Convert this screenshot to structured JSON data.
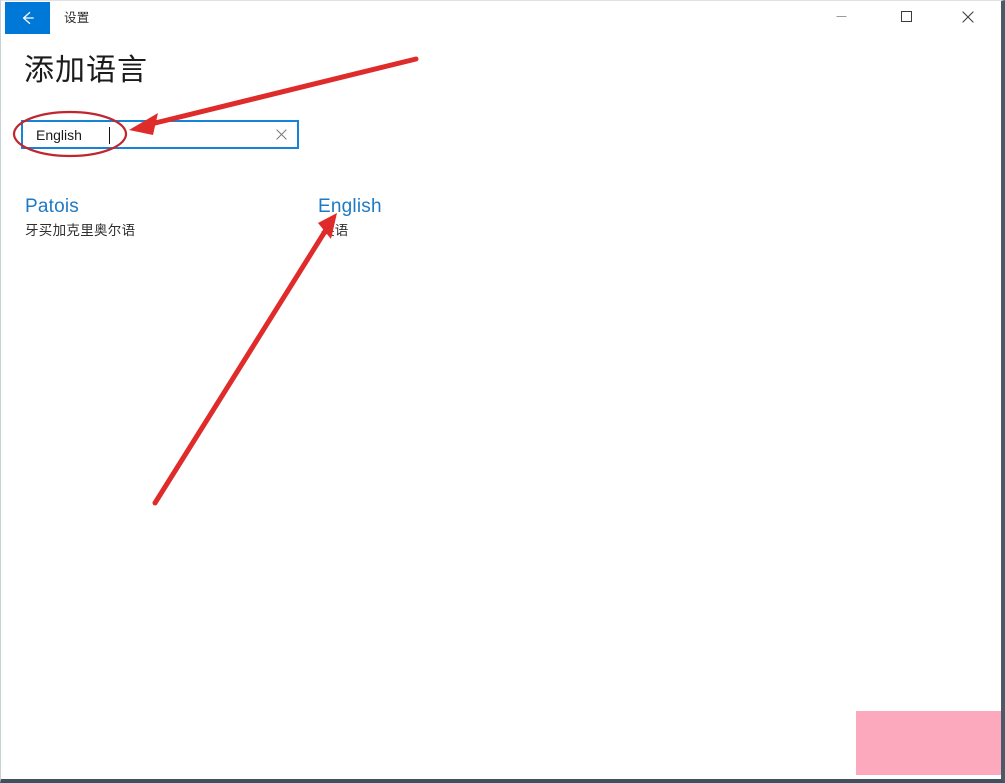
{
  "window": {
    "titlebar": {
      "title": "设置",
      "back_icon": "arrow-left-icon",
      "back_accent_color": "#0078d7",
      "minimize_icon": "minimize-icon",
      "maximize_icon": "maximize-icon",
      "close_icon": "close-icon"
    }
  },
  "page": {
    "title": "添加语言",
    "search": {
      "value": "English",
      "placeholder": "",
      "clear_icon": "clear-x-icon",
      "border_color": "#1683d8"
    },
    "results": [
      {
        "name": "Patois",
        "native_name": "牙买加克里奥尔语"
      },
      {
        "name": "English",
        "native_name": "英语"
      }
    ],
    "link_color": "#1e7ac4"
  },
  "annotations": {
    "ellipse": {
      "shape": "ellipse-highlight",
      "color": "#c0262e"
    },
    "arrow_to_search": {
      "shape": "arrow",
      "color": "#e02b2b"
    },
    "arrow_to_english": {
      "shape": "arrow",
      "color": "#e02b2b"
    },
    "pink_overlay": {
      "shape": "rectangle",
      "color": "#fca8bd"
    }
  }
}
